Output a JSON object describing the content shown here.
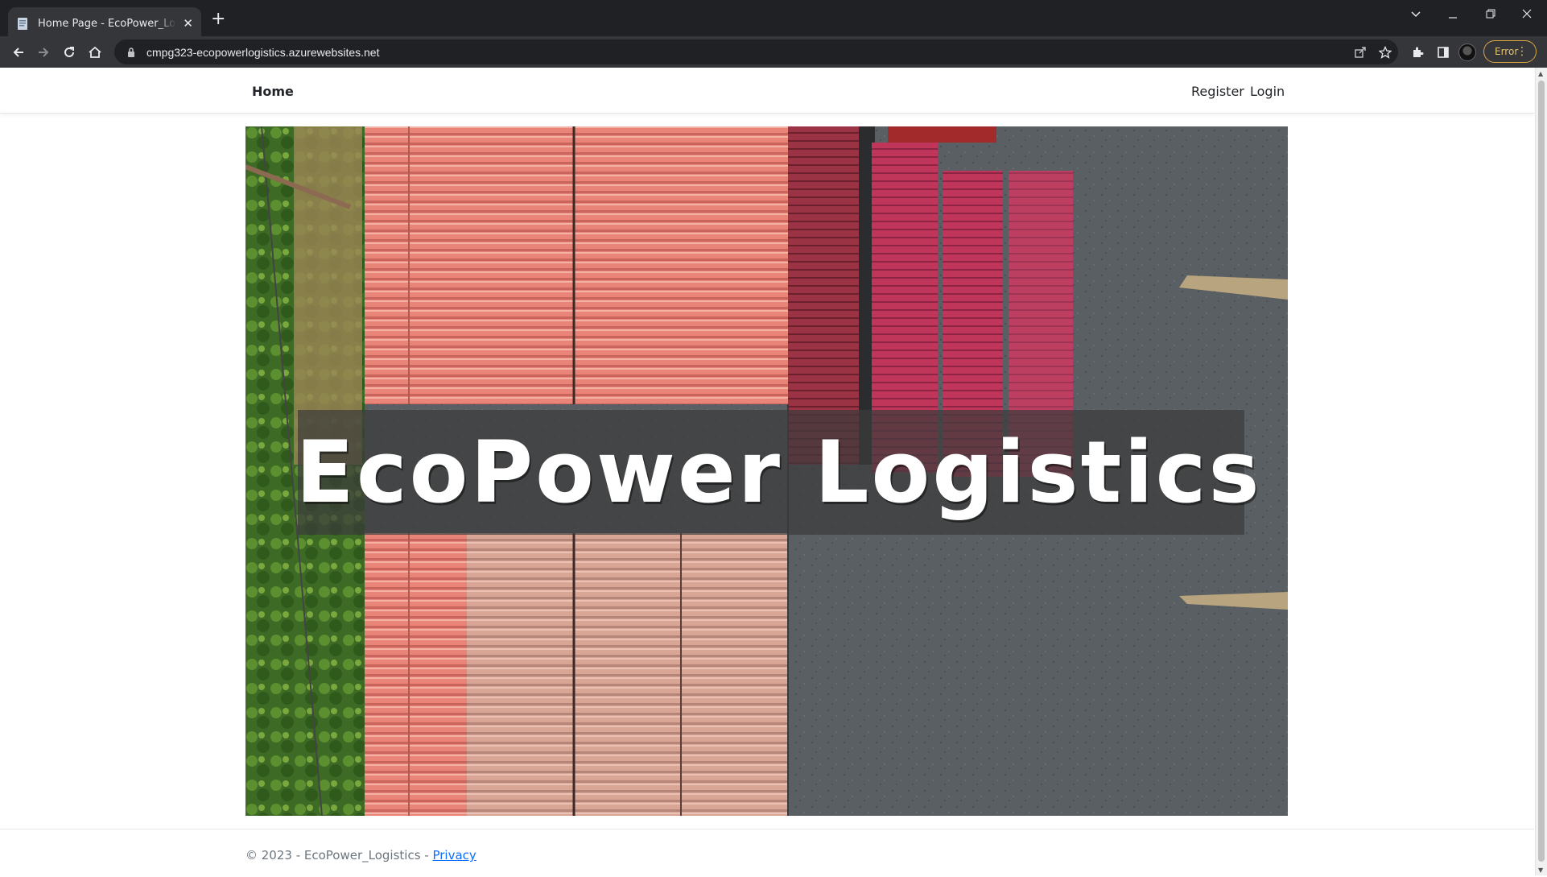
{
  "browser": {
    "tab_title": "Home Page - EcoPower_Logistics",
    "url": "cmpg323-ecopowerlogistics.azurewebsites.net",
    "error_label": "Error"
  },
  "site": {
    "brand": "Home",
    "nav": {
      "register": "Register",
      "login": "Login"
    },
    "hero_title": "EcoPower Logistics",
    "hero_image": "aerial-shipping-containers",
    "footer": {
      "copyright": "© 2023 - EcoPower_Logistics - ",
      "privacy": "Privacy"
    }
  },
  "icons": [
    "page-icon",
    "close-icon",
    "plus-icon",
    "chevron-down-icon",
    "minimize-icon",
    "restore-icon",
    "window-close-icon",
    "back-icon",
    "forward-icon",
    "reload-icon",
    "home-icon",
    "lock-icon",
    "share-icon",
    "star-icon",
    "extensions-icon",
    "side-panel-icon",
    "profile-avatar",
    "more-icon"
  ],
  "colors": {
    "chrome_bg": "#202124",
    "toolbar_bg": "#35363a",
    "link": "#0d6efd",
    "error": "#e8c16b"
  }
}
